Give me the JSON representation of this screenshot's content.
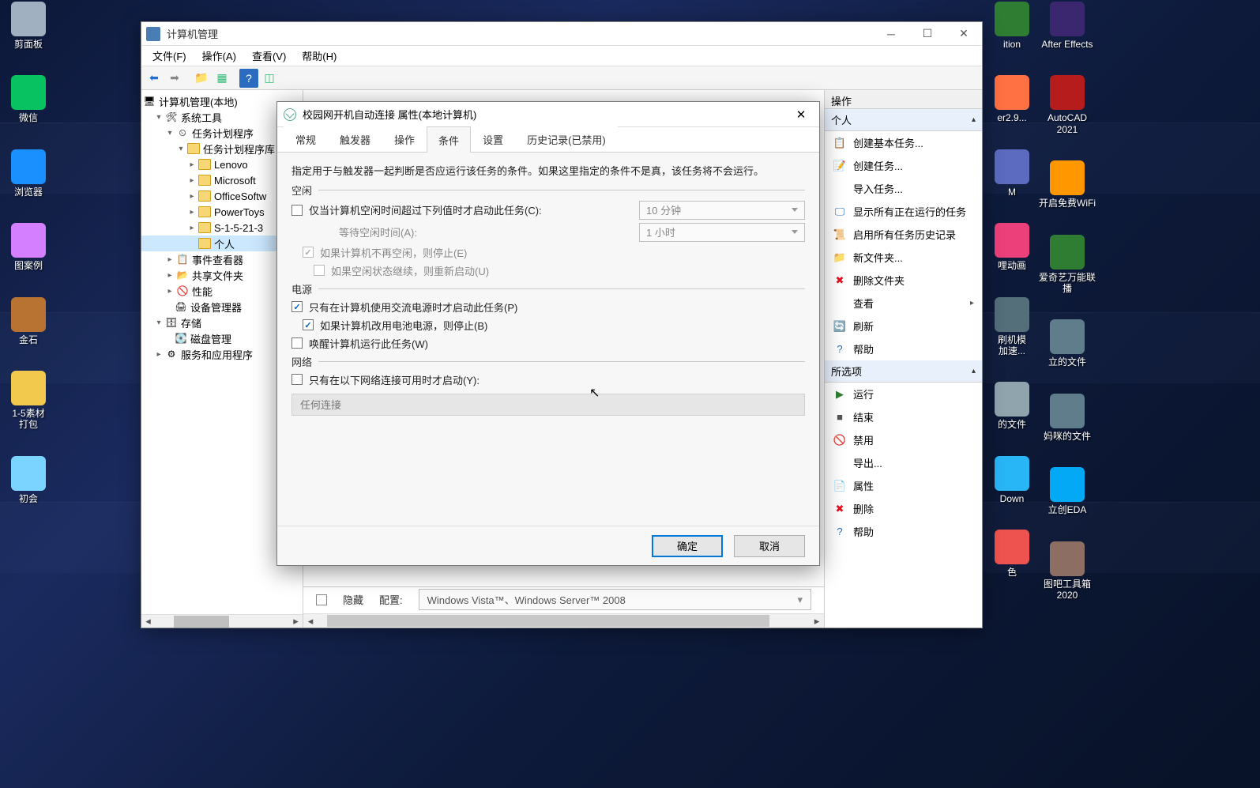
{
  "desktop": {
    "left": [
      {
        "label": "剪面板",
        "color": "#a0b0c0"
      },
      {
        "label": "微信",
        "color": "#08c160"
      },
      {
        "label": "浏览器",
        "color": "#1a90ff"
      },
      {
        "label": "图案例",
        "color": "#d47fff"
      },
      {
        "label": "金石",
        "color": "#b87333"
      },
      {
        "label": "1-5素材\n打包",
        "color": "#f2c94c"
      },
      {
        "label": "初会",
        "color": "#7bd4ff"
      }
    ],
    "r1": [
      {
        "label": "ition",
        "color": "#2e7d32"
      },
      {
        "label": "er2.9...",
        "color": "#ff7043"
      },
      {
        "label": "M",
        "color": "#5c6bc0"
      },
      {
        "label": "哩动画",
        "color": "#ec407a"
      },
      {
        "label": "刷机模\n加速...",
        "color": "#546e7a"
      },
      {
        "label": "的文件",
        "color": "#90a4ae"
      },
      {
        "label": "Down",
        "color": "#29b6f6"
      },
      {
        "label": "色",
        "color": "#ef5350"
      }
    ],
    "r2": [
      {
        "label": "After Effects",
        "color": "#3b2670"
      },
      {
        "label": "AutoCAD\n2021",
        "color": "#b71c1c"
      },
      {
        "label": "开启免费WiFi",
        "color": "#ff9800"
      },
      {
        "label": "爱奇艺万能联\n播",
        "color": "#2e7d32"
      },
      {
        "label": "立的文件",
        "color": "#607d8b"
      },
      {
        "label": "妈咪的文件",
        "color": "#607d8b"
      },
      {
        "label": "立创EDA",
        "color": "#03a9f4"
      },
      {
        "label": "图吧工具箱\n2020",
        "color": "#8d6e63"
      }
    ]
  },
  "window": {
    "title": "计算机管理",
    "menu": [
      "文件(F)",
      "操作(A)",
      "查看(V)",
      "帮助(H)"
    ],
    "tree": {
      "root": "计算机管理(本地)",
      "systools": "系统工具",
      "sched": "任务计划程序",
      "schedlib": "任务计划程序库",
      "folders": [
        "Lenovo",
        "Microsoft",
        "OfficeSoftw",
        "PowerToys",
        "S-1-5-21-3",
        "个人"
      ],
      "event": "事件查看器",
      "shared": "共享文件夹",
      "perf": "性能",
      "devmgr": "设备管理器",
      "storage": "存储",
      "diskmgr": "磁盘管理",
      "services": "服务和应用程序"
    },
    "bottom": {
      "hidden": "隐藏",
      "cfg_label": "配置:",
      "cfg_value": "Windows Vista™、Windows Server™ 2008"
    },
    "actions": {
      "header": "操作",
      "sect1": "个人",
      "items1": [
        "创建基本任务...",
        "创建任务...",
        "导入任务...",
        "显示所有正在运行的任务",
        "启用所有任务历史记录",
        "新文件夹...",
        "删除文件夹",
        "查看",
        "刷新",
        "帮助"
      ],
      "sect2": "所选项",
      "items2": [
        "运行",
        "结束",
        "禁用",
        "导出...",
        "属性",
        "删除",
        "帮助"
      ]
    }
  },
  "dialog": {
    "title": "校园网开机自动连接 属性(本地计算机)",
    "tabs": [
      "常规",
      "触发器",
      "操作",
      "条件",
      "设置",
      "历史记录(已禁用)"
    ],
    "active_tab": 3,
    "desc": "指定用于与触发器一起判断是否应运行该任务的条件。如果这里指定的条件不是真，该任务将不会运行。",
    "g_idle": "空闲",
    "idle_start": "仅当计算机空闲时间超过下列值时才启动此任务(C):",
    "idle_10": "10 分钟",
    "idle_wait_label": "等待空闲时间(A):",
    "idle_wait_val": "1 小时",
    "idle_stop": "如果计算机不再空闲，则停止(E)",
    "idle_restart": "如果空闲状态继续，则重新启动(U)",
    "g_power": "电源",
    "power_ac": "只有在计算机使用交流电源时才启动此任务(P)",
    "power_batt": "如果计算机改用电池电源，则停止(B)",
    "power_wake": "唤醒计算机运行此任务(W)",
    "g_net": "网络",
    "net_only": "只有在以下网络连接可用时才启动(Y):",
    "net_any": "任何连接",
    "ok": "确定",
    "cancel": "取消"
  }
}
